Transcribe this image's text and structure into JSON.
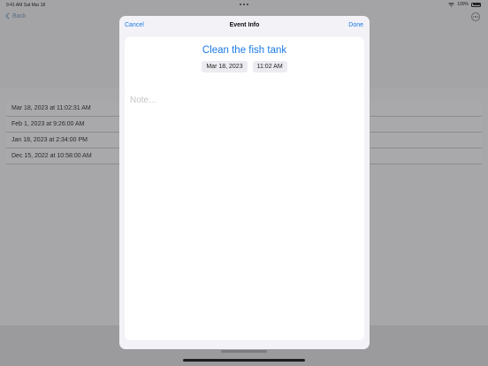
{
  "status_bar": {
    "time": "9:41 AM  Sat Mar 18",
    "battery": "100%"
  },
  "background": {
    "back_label": "Back",
    "rows": [
      "Mar 18, 2023 at 11:02:31 AM",
      "Feb 1, 2023 at 9:26:00 AM",
      "Jan 18, 2023 at 2:34:00 PM",
      "Dec 15, 2022 at 10:58:00 AM"
    ]
  },
  "sheet": {
    "cancel_label": "Cancel",
    "title": "Event Info",
    "done_label": "Done",
    "event_title": "Clean the fish tank",
    "date": "Mar 18, 2023",
    "time": "11:02 AM",
    "note_placeholder": "Note...",
    "note_value": ""
  },
  "colors": {
    "accent": "#1a7ae6"
  },
  "icons": [
    "chevron-left-icon",
    "ellipsis-circle-icon",
    "wifi-icon",
    "battery-icon"
  ]
}
